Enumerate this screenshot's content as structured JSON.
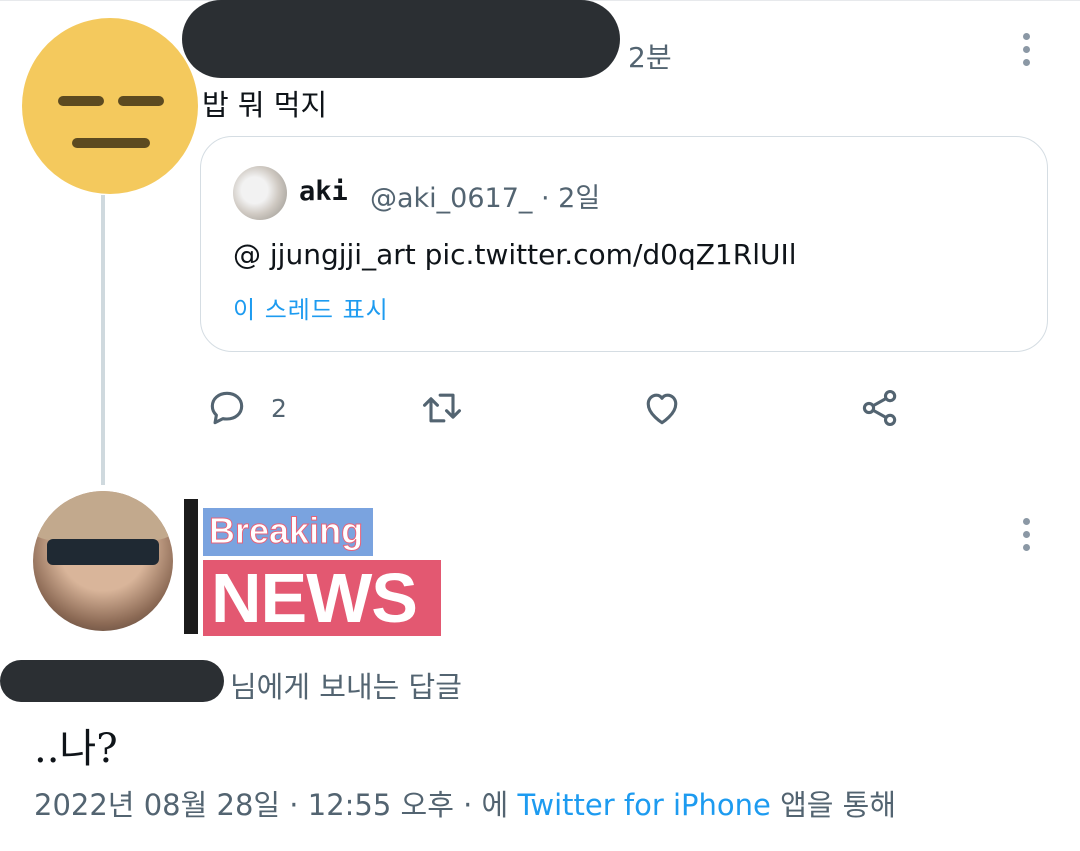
{
  "post1": {
    "time": "2분",
    "text": "밥 뭐 먹지",
    "quote": {
      "name": "aki",
      "handle_time": "@aki_0617_ · 2일",
      "text": "@ jjungjji_art pic.twitter.com/d0qZ1RlUIl",
      "thread_link": "이 스레드 표시"
    },
    "actions": {
      "reply_count": "2"
    }
  },
  "post2": {
    "badge": {
      "line1": "Breaking",
      "line2": "NEWS"
    },
    "replying_to": "님에게 보내는 답글",
    "text": "..나?",
    "meta": {
      "date": "2022년 08월 28일 · 12:55 오후 · 에 ",
      "client": "Twitter for iPhone",
      "suffix": " 앱을 통해"
    }
  },
  "colors": {
    "accent": "#1d9bf0",
    "muted": "#536471",
    "avatar_yellow": "#f4c95d"
  }
}
